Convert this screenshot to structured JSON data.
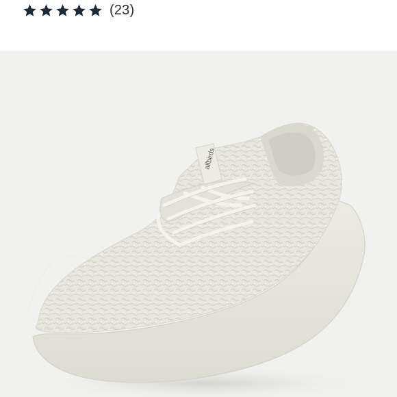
{
  "rating": {
    "stars_filled": 5,
    "stars_total": 5,
    "review_count_label": "(23)",
    "star_color": "#1f2a33"
  },
  "product_image": {
    "background_color": "#f1f1ef",
    "subject": "shoe-image",
    "logo_text": "allbirds"
  }
}
